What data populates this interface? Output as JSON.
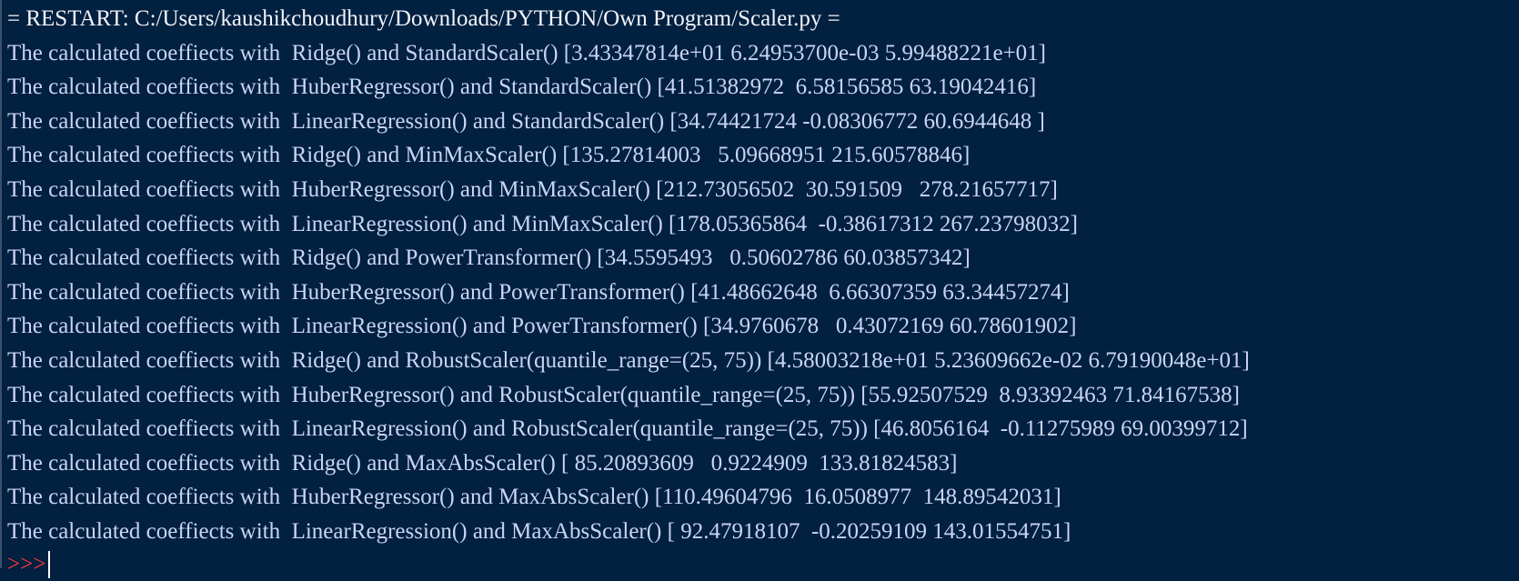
{
  "restart_line": "= RESTART: C:/Users/kaushikchoudhury/Downloads/PYTHON/Own Program/Scaler.py =",
  "output_lines": [
    "The calculated coeffiects with  Ridge() and StandardScaler() [3.43347814e+01 6.24953700e-03 5.99488221e+01]",
    "The calculated coeffiects with  HuberRegressor() and StandardScaler() [41.51382972  6.58156585 63.19042416]",
    "The calculated coeffiects with  LinearRegression() and StandardScaler() [34.74421724 -0.08306772 60.6944648 ]",
    "The calculated coeffiects with  Ridge() and MinMaxScaler() [135.27814003   5.09668951 215.60578846]",
    "The calculated coeffiects with  HuberRegressor() and MinMaxScaler() [212.73056502  30.591509   278.21657717]",
    "The calculated coeffiects with  LinearRegression() and MinMaxScaler() [178.05365864  -0.38617312 267.23798032]",
    "The calculated coeffiects with  Ridge() and PowerTransformer() [34.5595493   0.50602786 60.03857342]",
    "The calculated coeffiects with  HuberRegressor() and PowerTransformer() [41.48662648  6.66307359 63.34457274]",
    "The calculated coeffiects with  LinearRegression() and PowerTransformer() [34.9760678   0.43072169 60.78601902]",
    "The calculated coeffiects with  Ridge() and RobustScaler(quantile_range=(25, 75)) [4.58003218e+01 5.23609662e-02 6.79190048e+01]",
    "The calculated coeffiects with  HuberRegressor() and RobustScaler(quantile_range=(25, 75)) [55.92507529  8.93392463 71.84167538]",
    "The calculated coeffiects with  LinearRegression() and RobustScaler(quantile_range=(25, 75)) [46.8056164  -0.11275989 69.00399712]",
    "The calculated coeffiects with  Ridge() and MaxAbsScaler() [ 85.20893609   0.9224909  133.81824583]",
    "The calculated coeffiects with  HuberRegressor() and MaxAbsScaler() [110.49604796  16.0508977  148.89542031]",
    "The calculated coeffiects with  LinearRegression() and MaxAbsScaler() [ 92.47918107  -0.20259109 143.01554751]"
  ],
  "prompt": ">>>",
  "colors": {
    "background": "#022040",
    "text": "#c9d5f2",
    "prompt": "#ff3b3b"
  }
}
